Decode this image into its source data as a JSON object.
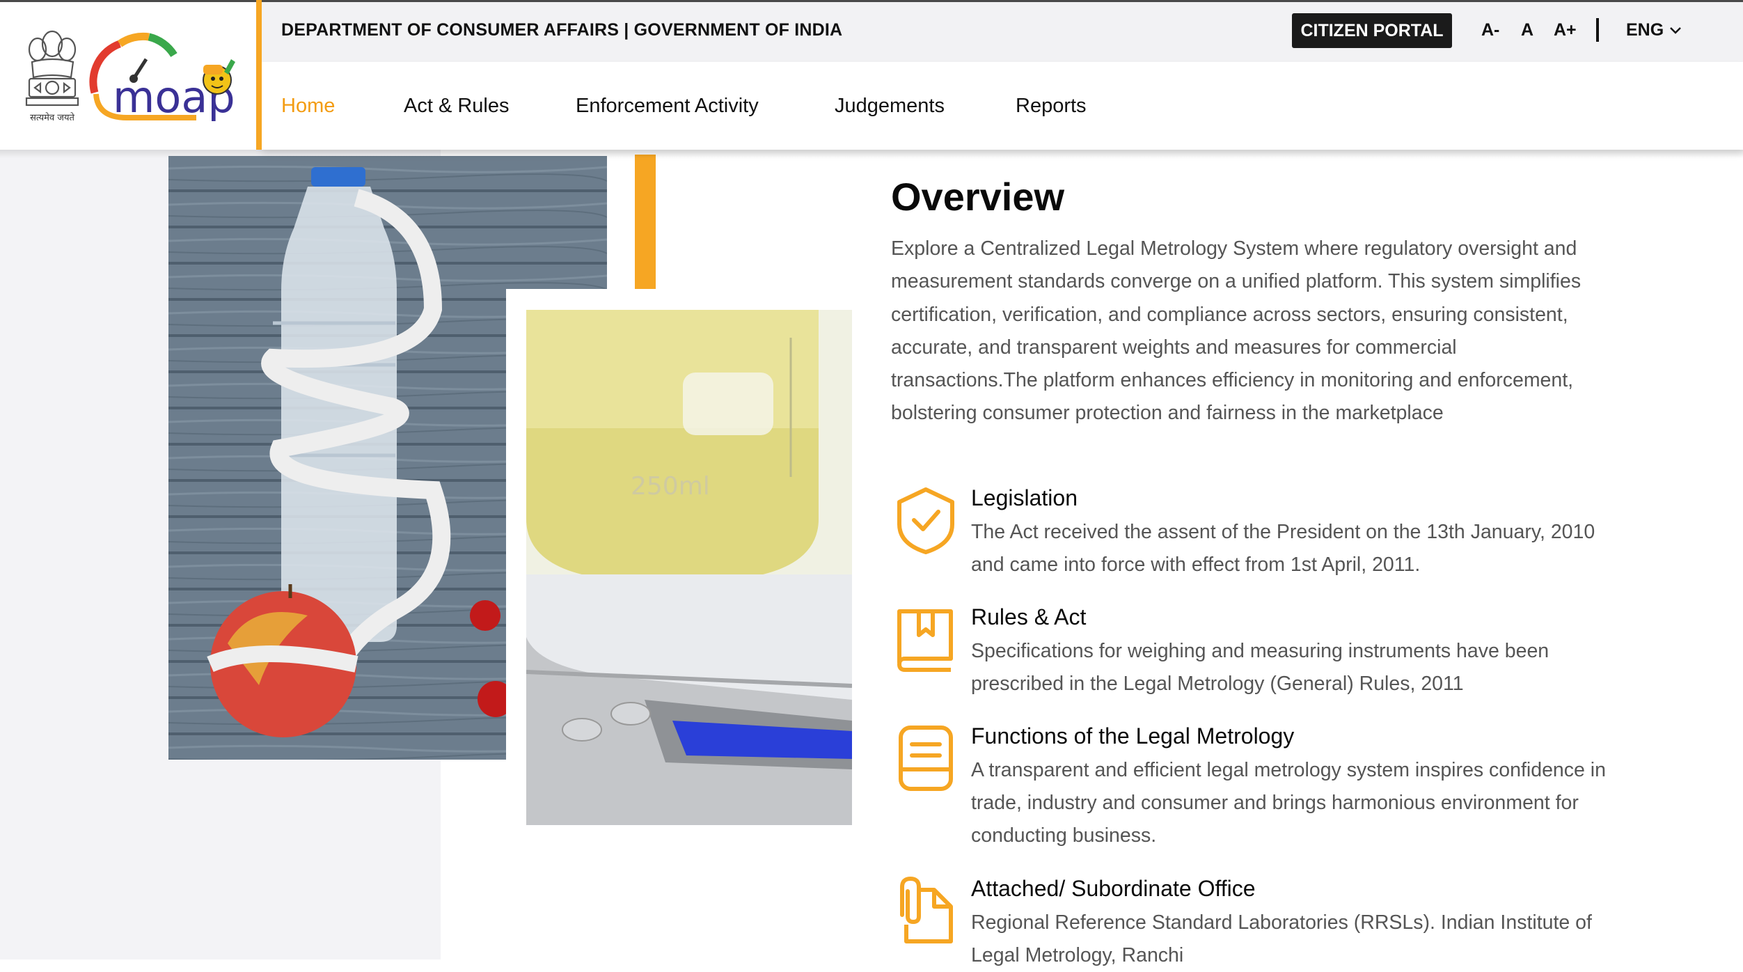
{
  "header": {
    "department": "DEPARTMENT OF CONSUMER AFFAIRS | GOVERNMENT OF INDIA",
    "citizen_portal": "CITIZEN PORTAL",
    "font_decrease": "A-",
    "font_normal": "A",
    "font_increase": "A+",
    "language": "ENG",
    "emblem_motto": "सत्यमेव जयते",
    "logo_text": "moap"
  },
  "nav": {
    "items": [
      {
        "label": "Home",
        "active": true
      },
      {
        "label": "Act & Rules",
        "active": false
      },
      {
        "label": "Enforcement Activity",
        "active": false
      },
      {
        "label": "Judgements",
        "active": false
      },
      {
        "label": "Reports",
        "active": false
      }
    ]
  },
  "overview": {
    "title": "Overview",
    "text": "Explore a Centralized Legal Metrology System where regulatory oversight and measurement standards converge on a unified platform. This system simplifies certification, verification, and compliance across sectors, ensuring consistent, accurate, and transparent weights and measures for commercial transactions.The platform enhances efficiency in monitoring and enforcement, bolstering consumer protection and fairness in the marketplace"
  },
  "features": [
    {
      "title": "Legislation",
      "text": "The Act received the assent of the President on the 13th January, 2010 and came into force with effect from 1st April, 2011.",
      "icon": "shield-check-icon"
    },
    {
      "title": "Rules & Act",
      "text": "Specifications for weighing and measuring instruments have been prescribed in the Legal Metrology (General) Rules, 2011",
      "icon": "book-icon"
    },
    {
      "title": "Functions of the Legal Metrology",
      "text": "A transparent and efficient legal metrology system inspires confidence in trade, industry and consumer and brings harmonious environment for conducting business.",
      "icon": "document-icon"
    },
    {
      "title": "Attached/ Subordinate Office",
      "text": "Regional Reference Standard Laboratories (RRSLs). Indian Institute of Legal Metrology, Ranchi",
      "icon": "paperclip-file-icon"
    }
  ],
  "photos": {
    "photo1_label": "250ml"
  },
  "colors": {
    "accent": "#f6a623",
    "nav_active": "#f39c12",
    "portal_button": "#1b1b1b",
    "util_bar": "#f2f2f4"
  }
}
